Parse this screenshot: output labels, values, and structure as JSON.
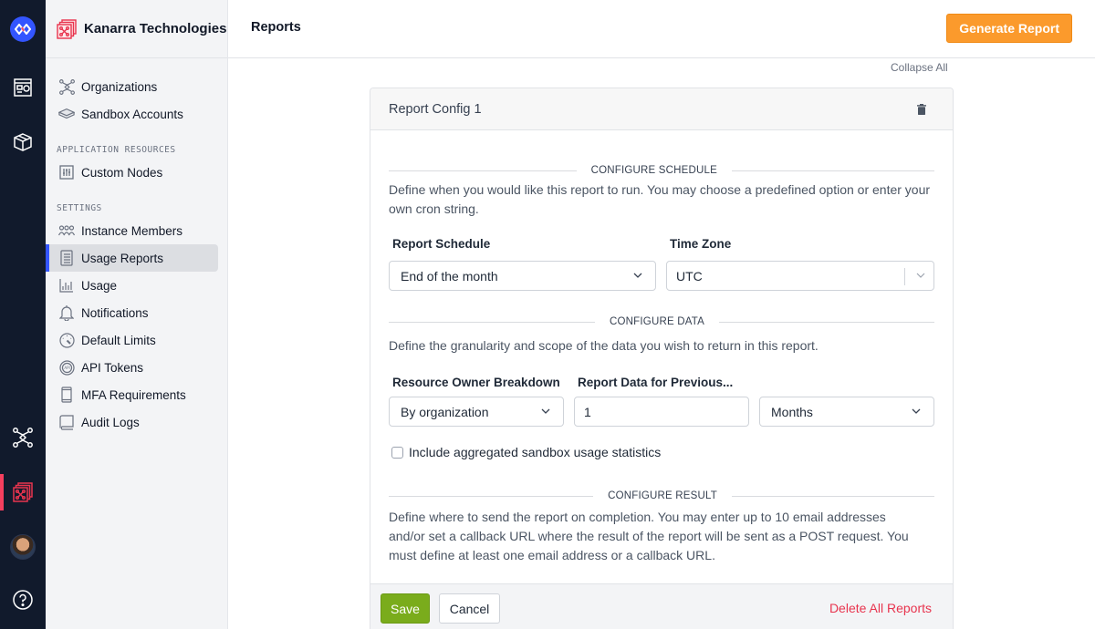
{
  "rail": {
    "items": [
      {
        "name": "app-logo",
        "icon": "infinity-logo-icon"
      },
      {
        "name": "dashboard",
        "icon": "dashboard-icon"
      },
      {
        "name": "packages",
        "icon": "cube-icon"
      },
      {
        "name": "nodes",
        "icon": "network-icon"
      },
      {
        "name": "organization",
        "icon": "org-stack-icon",
        "active": true
      },
      {
        "name": "user",
        "icon": "avatar"
      },
      {
        "name": "help",
        "icon": "help-icon"
      }
    ]
  },
  "sidebar": {
    "org_name": "Kanarra Technologies",
    "items_top": [
      {
        "label": "Organizations",
        "icon": "organizations-icon"
      },
      {
        "label": "Sandbox Accounts",
        "icon": "sandbox-icon"
      }
    ],
    "section_app": "APPLICATION RESOURCES",
    "items_app": [
      {
        "label": "Custom Nodes",
        "icon": "sliders-icon"
      }
    ],
    "section_settings": "SETTINGS",
    "items_settings": [
      {
        "label": "Instance Members",
        "icon": "members-icon"
      },
      {
        "label": "Usage Reports",
        "icon": "notebook-icon",
        "active": true
      },
      {
        "label": "Usage",
        "icon": "bar-chart-icon"
      },
      {
        "label": "Notifications",
        "icon": "bell-icon"
      },
      {
        "label": "Default Limits",
        "icon": "gauge-icon"
      },
      {
        "label": "API Tokens",
        "icon": "api-icon"
      },
      {
        "label": "MFA Requirements",
        "icon": "phone-icon"
      },
      {
        "label": "Audit Logs",
        "icon": "book-icon"
      }
    ]
  },
  "header": {
    "title": "Reports",
    "generate_label": "Generate Report"
  },
  "collapse_all": "Collapse All",
  "card": {
    "title": "Report Config 1",
    "schedule": {
      "heading": "CONFIGURE SCHEDULE",
      "description": "Define when you would like this report to run. You may choose a predefined option or enter your own cron string.",
      "report_schedule_label": "Report Schedule",
      "report_schedule_value": "End of the month",
      "time_zone_label": "Time Zone",
      "time_zone_value": "UTC"
    },
    "data": {
      "heading": "CONFIGURE DATA",
      "description": "Define the granularity and scope of the data you wish to return in this report.",
      "owner_label": "Resource Owner Breakdown",
      "owner_value": "By organization",
      "previous_label": "Report Data for Previous...",
      "previous_value": "1",
      "unit_value": "Months",
      "checkbox_label": "Include aggregated sandbox usage statistics",
      "checkbox_checked": false
    },
    "result": {
      "heading": "CONFIGURE RESULT",
      "description": "Define where to send the report on completion. You may enter up to 10 email addresses and/or set a callback URL where the result of the report will be sent as a POST request. You must define at least one email address or a callback URL."
    }
  },
  "footer": {
    "save_label": "Save",
    "cancel_label": "Cancel",
    "delete_all_label": "Delete All Reports"
  },
  "colors": {
    "accent_blue": "#3355ff",
    "generate_orange": "#fb9a2c",
    "save_green": "#7aac1c",
    "danger_red": "#e8344e",
    "rail_bg": "#111a2c"
  }
}
